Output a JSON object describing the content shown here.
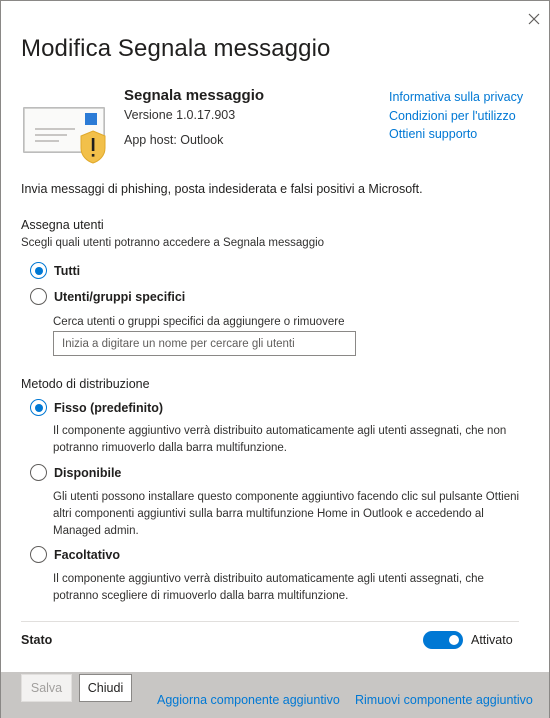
{
  "panel": {
    "title": "Modifica Segnala messaggio",
    "close_label": "Chiudi pannello"
  },
  "app": {
    "name": "Segnala messaggio",
    "version": "Versione 1.0.17.903",
    "host": "App host: Outlook",
    "links": [
      "Informativa sulla privacy",
      "Condizioni per l'utilizzo",
      "Ottieni supporto"
    ]
  },
  "description": "Invia messaggi di phishing, posta indesiderata e falsi positivi a Microsoft.",
  "assign": {
    "title": "Assegna utenti",
    "subtitle": "Scegli quali utenti potranno accedere a Segnala messaggio",
    "options": [
      {
        "label": "Tutti",
        "checked": true
      },
      {
        "label": "Utenti/gruppi specifici",
        "checked": false
      }
    ],
    "search_hint": "Cerca utenti o gruppi specifici da aggiungere o rimuovere",
    "search_placeholder": "Inizia a digitare un nome per cercare gli utenti"
  },
  "distribution": {
    "title": "Metodo di distribuzione",
    "options": [
      {
        "label": "Fisso (predefinito)",
        "checked": true,
        "description": "Il componente aggiuntivo verrà distribuito automaticamente agli utenti assegnati, che non potranno rimuoverlo dalla barra multifunzione."
      },
      {
        "label": "Disponibile",
        "checked": false,
        "description": "Gli utenti possono installare questo componente aggiuntivo facendo clic sul pulsante Ottieni altri componenti aggiuntivi sulla barra multifunzione Home in Outlook e accedendo al Managed admin."
      },
      {
        "label": "Facoltativo",
        "checked": false,
        "description": "Il componente aggiuntivo verrà distribuito automaticamente agli utenti assegnati, che potranno scegliere di rimuoverlo dalla barra multifunzione."
      }
    ]
  },
  "state": {
    "label": "Stato",
    "toggle_on": true,
    "toggle_label": "Attivato"
  },
  "footer": {
    "save_label": "Salva",
    "close_label": "Chiudi",
    "update_link": "Aggiorna componente aggiuntivo",
    "remove_link": "Rimuovi componente aggiuntivo"
  },
  "colors": {
    "accent": "#0078d4",
    "warning": "#f2c04a",
    "footer_bg": "#c8c6c4"
  }
}
